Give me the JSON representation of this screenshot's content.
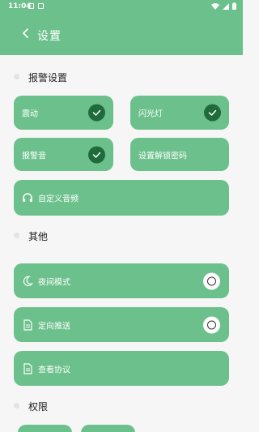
{
  "status_bar": {
    "time": "11:04"
  },
  "app_bar": {
    "title": "设置"
  },
  "sections": {
    "alarm": "报警设置",
    "other": "其他",
    "permission": "权限"
  },
  "alarm_cards": {
    "vibrate": "震动",
    "flashlight": "闪光灯",
    "alarm_sound": "报警音",
    "unlock_password": "设置解锁密码",
    "custom_sound": "自定义音频"
  },
  "other_cards": {
    "night_mode": "夜间模式",
    "targeted_push": "定向推送",
    "view_agreement": "查看协议"
  },
  "colors": {
    "accent": "#6cc08b",
    "check": "#1f6b3c",
    "background": "#f6f6f6"
  }
}
